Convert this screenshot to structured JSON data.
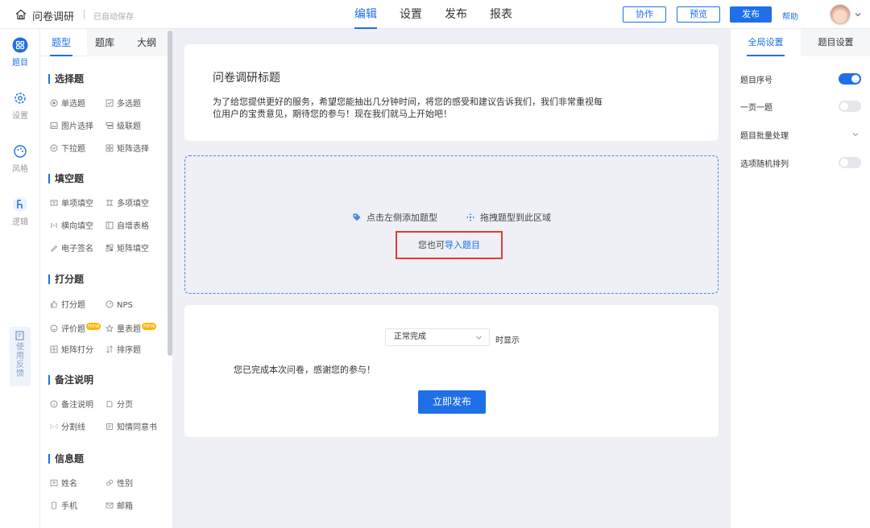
{
  "header": {
    "app_title": "问卷调研",
    "autosave": "已自动保存",
    "nav": [
      "编辑",
      "设置",
      "发布",
      "报表"
    ],
    "collab_label": "协作",
    "preview_label": "预览",
    "publish_label": "发布",
    "help_label": "帮助"
  },
  "rail": {
    "items": [
      "题目",
      "设置",
      "风格",
      "逻辑"
    ],
    "feedback": "使用反馈"
  },
  "left_panel": {
    "tabs": [
      "题型",
      "题库",
      "大纲"
    ],
    "sections": [
      {
        "title": "选择题",
        "items": [
          "单选题",
          "多选题",
          "图片选择",
          "级联题",
          "下拉题",
          "矩阵选择"
        ]
      },
      {
        "title": "填空题",
        "items": [
          "单项填空",
          "多项填空",
          "横向填空",
          "自增表格",
          "电子签名",
          "矩阵填空"
        ]
      },
      {
        "title": "打分题",
        "items": [
          "打分题",
          "NPS",
          "评价题",
          "量表题",
          "矩阵打分",
          "排序题"
        ]
      },
      {
        "title": "备注说明",
        "items": [
          "备注说明",
          "分页",
          "分割线",
          "知情同意书"
        ]
      },
      {
        "title": "信息题",
        "items": [
          "姓名",
          "性别",
          "手机",
          "邮箱"
        ]
      }
    ],
    "new_badge": "new"
  },
  "survey": {
    "title": "问卷调研标题",
    "description": "为了给您提供更好的服务，希望您能抽出几分钟时间，将您的感受和建议告诉我们，我们非常重视每位用户的宝贵意见，期待您的参与！现在我们就马上开始吧！"
  },
  "drop_zone": {
    "hint_left": "点击左侧添加题型",
    "hint_right": "拖拽题型到此区域",
    "import_prefix": "您也可",
    "import_link": "导入题目"
  },
  "finish": {
    "select_value": "正常完成",
    "time_show": "时显示",
    "message": "您已完成本次问卷，感谢您的参与！",
    "publish_now": "立即发布"
  },
  "right_panel": {
    "tabs": [
      "全局设置",
      "题目设置"
    ],
    "settings": [
      {
        "label": "题目序号",
        "on": true
      },
      {
        "label": "一页一题",
        "on": false
      },
      {
        "label": "题目批量处理"
      },
      {
        "label": "选项随机排列",
        "on": false
      }
    ]
  },
  "colors": {
    "accent": "#1e6fe8",
    "highlight_box": "#e53935",
    "badge": "#ffb400"
  }
}
